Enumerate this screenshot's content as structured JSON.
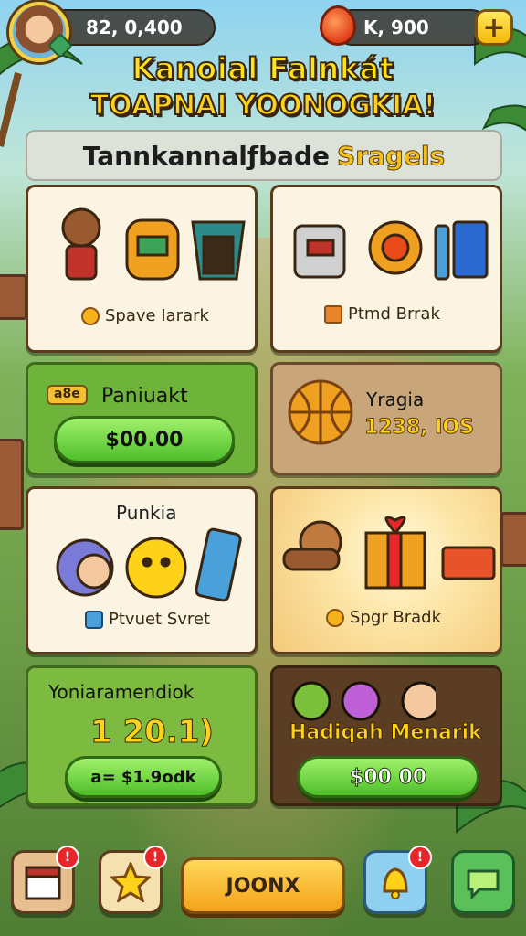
{
  "header": {
    "coins": "82, 0,400",
    "gems": "K, 900",
    "add_label": "+"
  },
  "titles": {
    "line1": "Kanoial Falnkát",
    "line2": "TOAPNAI YOONOGKIA!",
    "banner_main": "Tannkannalƒbade",
    "banner_highlight": "Sragels"
  },
  "cards": {
    "c1_label": "Spave Iarark",
    "c2_label": "Ptmd Brrak",
    "c3_badge": "a8e",
    "c3_title": "Paniuakt",
    "c3_price": "$00.00",
    "c4_title": "Yragia",
    "c4_value": "1238, IOS",
    "c5_title": "Punkia",
    "c5_label": "Ptvuet Svret",
    "c6_label": "Spgr Bradk",
    "c7_title": "Yoniaramendiok",
    "c7_value": "1 20.1)",
    "c7_price": "a= $1.9odk",
    "c8_title": "Hadiqah Menarik",
    "c8_price": "$00 00"
  },
  "bottom_nav": {
    "main_button": "JOONX",
    "badge1": "!",
    "badge2": "!",
    "badge3": "!"
  },
  "colors": {
    "accent_yellow": "#ffe21a",
    "button_green": "#4fbf2a",
    "card_cream": "#fbf4e2"
  },
  "icons": [
    "player-avatar-icon",
    "coin-icon",
    "ruby-gem-icon",
    "plus-icon",
    "gift-icon",
    "basketball-icon",
    "store-icon",
    "star-icon",
    "bell-icon",
    "chat-icon"
  ]
}
